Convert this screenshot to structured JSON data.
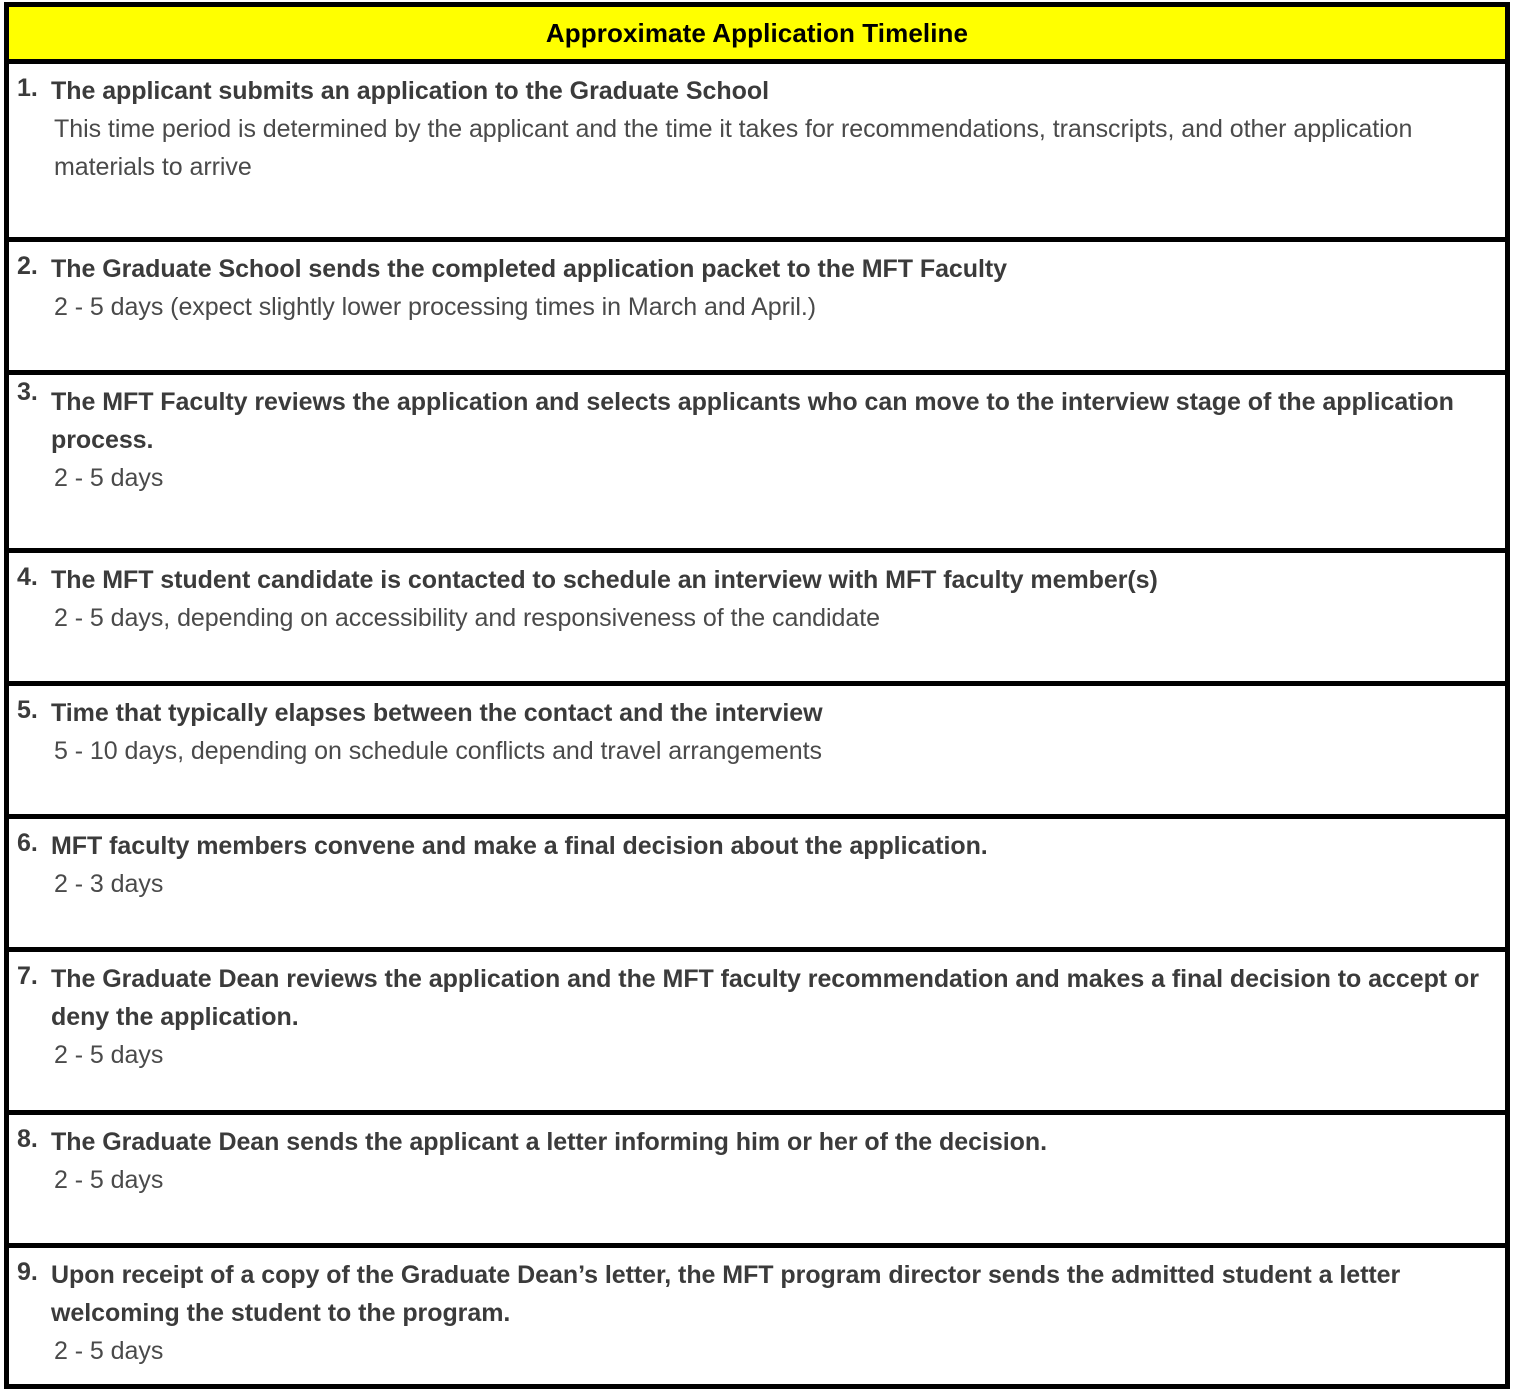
{
  "header": {
    "title": "Approximate Application Timeline",
    "background_color": "#FFFF00",
    "text_color": "#000000"
  },
  "colors": {
    "border": "#000000",
    "page_background": "#FFFFFF",
    "heading_text": "#3B3B3B",
    "detail_text": "#4A4A4A",
    "highlight": "#FFFF00"
  },
  "steps": [
    {
      "number": "1.",
      "title": "The applicant submits an application to the Graduate School",
      "detail": "This time period is determined by the applicant and the time it takes for recommendations, transcripts, and other application materials to arrive"
    },
    {
      "number": "2.",
      "title": "The Graduate School sends the completed application packet to the MFT Faculty",
      "detail": "2 - 5 days (expect slightly lower processing times in March and April.)"
    },
    {
      "number": "3.",
      "title": "The MFT Faculty reviews the application and selects applicants who can move to the interview stage of the application process.",
      "detail": "2 - 5 days"
    },
    {
      "number": "4.",
      "title": "The MFT student candidate is contacted to schedule an interview with MFT faculty member(s)",
      "detail": "2 - 5 days, depending on accessibility and responsiveness of the candidate"
    },
    {
      "number": "5.",
      "title": "Time that typically elapses between the contact and the interview",
      "detail": "5 - 10 days, depending on schedule conflicts and travel arrangements"
    },
    {
      "number": "6.",
      "title": "MFT faculty members convene and make a final decision about the application.",
      "detail": "2 - 3 days"
    },
    {
      "number": "7.",
      "title": "The Graduate Dean reviews the application and the MFT faculty recommendation and makes a final decision to accept or deny the application.",
      "detail": "2 - 5 days"
    },
    {
      "number": "8.",
      "title": "The Graduate Dean sends the applicant a letter informing him or her of the decision.",
      "detail": "2 - 5 days"
    },
    {
      "number": "9.",
      "title": "Upon receipt of a copy of the Graduate Dean’s letter, the MFT program director sends the admitted student a letter welcoming the student to the program.",
      "detail": "2 - 5 days"
    }
  ]
}
